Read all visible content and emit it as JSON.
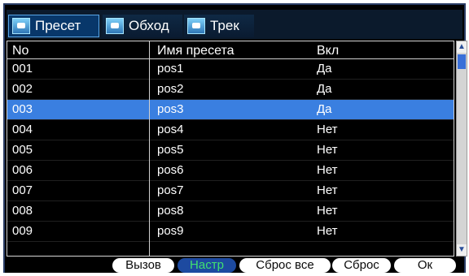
{
  "tabs": [
    {
      "label": "Пресет",
      "icon": "camera-icon",
      "active": true
    },
    {
      "label": "Обход",
      "icon": "camera-icon",
      "active": false
    },
    {
      "label": "Трек",
      "icon": "camera-icon",
      "active": false
    }
  ],
  "table": {
    "headers": [
      "No",
      "Имя пресета",
      "Вкл"
    ],
    "rows": [
      [
        "001",
        "pos1",
        "Да"
      ],
      [
        "002",
        "pos2",
        "Да"
      ],
      [
        "003",
        "pos3",
        "Да"
      ],
      [
        "004",
        "pos4",
        "Нет"
      ],
      [
        "005",
        "pos5",
        "Нет"
      ],
      [
        "006",
        "pos6",
        "Нет"
      ],
      [
        "007",
        "pos7",
        "Нет"
      ],
      [
        "008",
        "pos8",
        "Нет"
      ],
      [
        "009",
        "pos9",
        "Нет"
      ]
    ],
    "selected_index": 2
  },
  "buttons": [
    {
      "label": "Вызов",
      "active": false
    },
    {
      "label": "Настр",
      "active": true
    },
    {
      "label": "Сброс все",
      "active": false
    },
    {
      "label": "Сброс",
      "active": false
    },
    {
      "label": "Ок",
      "active": false
    }
  ],
  "colors": {
    "selection": "#3a7fe0",
    "active_button_text": "#40e070",
    "background": "#000000"
  }
}
